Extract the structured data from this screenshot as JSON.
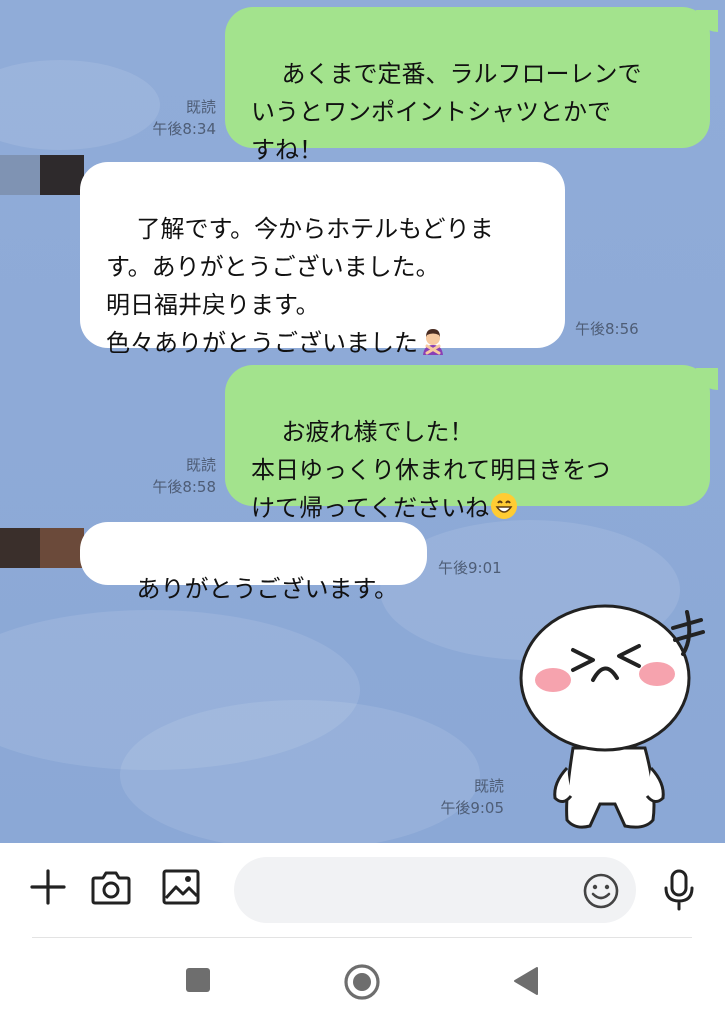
{
  "chat": {
    "messages": [
      {
        "direction": "out",
        "text": "あくまで定番、ラルフローレンで\nいうとワンポイントシャツとかで\nすね！",
        "read": "既読",
        "time": "午後8:34"
      },
      {
        "direction": "in",
        "text": "了解です。今からホテルもどりま\nす。ありがとうございました。\n明日福井戻ります。\n色々ありがとうございました",
        "emoji": "person-gesturing-no-emoji",
        "time": "午後8:56"
      },
      {
        "direction": "out",
        "text": "お疲れ様でした！\n本日ゆっくり休まれて明日きをつ\nけて帰ってくださいね",
        "emoji": "grinning-smile-emoji",
        "read": "既読",
        "time": "午後8:58"
      },
      {
        "direction": "in",
        "text": "ありがとうございます。",
        "time": "午後9:01"
      },
      {
        "direction": "out",
        "type": "sticker",
        "sticker": "laughing-face-sticker",
        "read": "既読",
        "time": "午後9:05"
      }
    ]
  },
  "input_bar": {
    "plus_icon": "plus-icon",
    "camera_icon": "camera-icon",
    "image_icon": "image-icon",
    "message_placeholder": "",
    "emoji_icon": "smiley-icon",
    "mic_icon": "microphone-icon"
  },
  "nav": {
    "recents_icon": "square-icon",
    "home_icon": "circle-icon",
    "back_icon": "triangle-back-icon"
  },
  "colors": {
    "chat_background": "#8eaad7",
    "outgoing_bubble": "#a3e38d",
    "incoming_bubble": "#ffffff",
    "meta_text": "#4e5d76"
  }
}
